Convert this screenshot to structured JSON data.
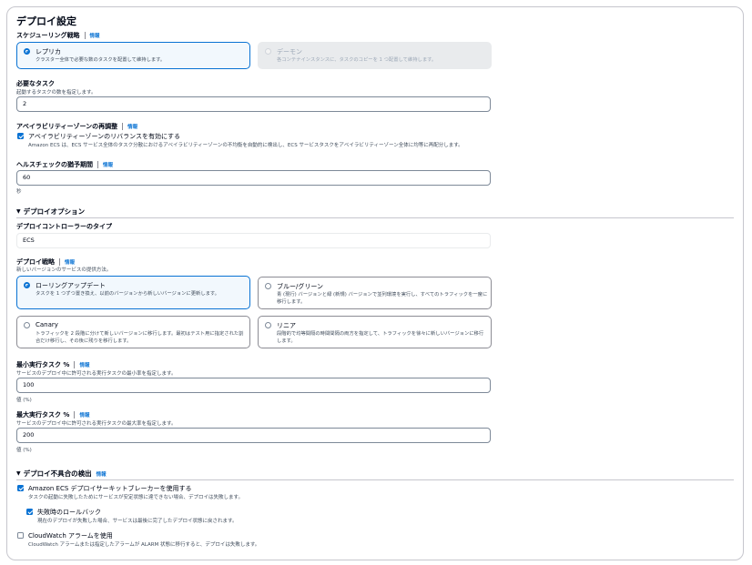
{
  "deploy": {
    "title": "デプロイ設定",
    "info_label": "情報",
    "scheduling": {
      "label": "スケジューリング戦略",
      "options": [
        {
          "title": "レプリカ",
          "desc": "クラスター全体で必要な数のタスクを配置して維持します。",
          "selected": true,
          "disabled": false
        },
        {
          "title": "デーモン",
          "desc": "各コンテナインスタンスに、タスクのコピーを 1 つ配置して維持します。",
          "selected": false,
          "disabled": true
        }
      ]
    },
    "desired_tasks": {
      "label": "必要なタスク",
      "desc": "起動するタスクの数を指定します。",
      "value": "2"
    },
    "az_rebalance": {
      "label": "アベイラビリティーゾーンの再調整",
      "checkbox_label": "アベイラビリティーゾーンのリバランスを有効にする",
      "checked": true,
      "desc": "Amazon ECS は、ECS サービス全体のタスク分散におけるアベイラビリティーゾーンの不均衡を自動的に検出し、ECS サービスタスクをアベイラビリティーゾーン全体に均等に再配分します。"
    },
    "health_grace": {
      "label": "ヘルスチェックの猶予期間",
      "value": "60",
      "unit": "秒"
    }
  },
  "deploy_options": {
    "title": "デプロイオプション",
    "controller": {
      "label": "デプロイコントローラーのタイプ",
      "value": "ECS"
    },
    "strategy": {
      "label": "デプロイ戦略",
      "desc": "新しいバージョンのサービスの提供方法。",
      "options": [
        {
          "title": "ローリングアップデート",
          "desc": "タスクを 1 つずつ置き換え、以前のバージョンから新しいバージョンに更新します。",
          "selected": true
        },
        {
          "title": "ブルー/グリーン",
          "desc": "青 (現行) バージョンと緑 (新規) バージョンで並列環境を実行し、すべてのトラフィックを一度に移行します。",
          "selected": false
        },
        {
          "title": "Canary",
          "desc": "トラフィックを 2 段階に分けて新しいバージョンに移行します。最初はテスト用に指定された割合だけ移行し、その後に残りを移行します。",
          "selected": false
        },
        {
          "title": "リニア",
          "desc": "段階的で均等間隔の時間間隔の両方を指定して、トラフィックを徐々に新しいバージョンに移行します。",
          "selected": false
        }
      ]
    },
    "min_running": {
      "label": "最小実行タスク %",
      "desc": "サービスのデプロイ中に許可される実行タスクの最小率を指定します。",
      "value": "100",
      "unit": "値 (%)"
    },
    "max_running": {
      "label": "最大実行タスク %",
      "desc": "サービスのデプロイ中に許可される実行タスクの最大率を指定します。",
      "value": "200",
      "unit": "値 (%)"
    }
  },
  "failure_detection": {
    "title": "デプロイ不具合の検出",
    "circuit_breaker": {
      "label": "Amazon ECS デプロイサーキットブレーカーを使用する",
      "desc": "タスクの起動に失敗したためにサービスが安定状態に達できない場合、デプロイは失敗します。",
      "checked": true
    },
    "rollback": {
      "label": "失敗時のロールバック",
      "desc": "現在のデプロイが失敗した場合、サービスは最後に完了したデプロイ状態に戻されます。",
      "checked": true
    },
    "cloudwatch": {
      "label": "CloudWatch アラームを使用",
      "desc": "CloudWatch アラームまたは指定したアラームが ALARM 状態に移行すると、デプロイは失敗します。",
      "checked": false
    }
  },
  "colors": {
    "accent": "#0972d3",
    "border": "#8c8c94",
    "text": "#000716",
    "muted": "#414d5c"
  }
}
